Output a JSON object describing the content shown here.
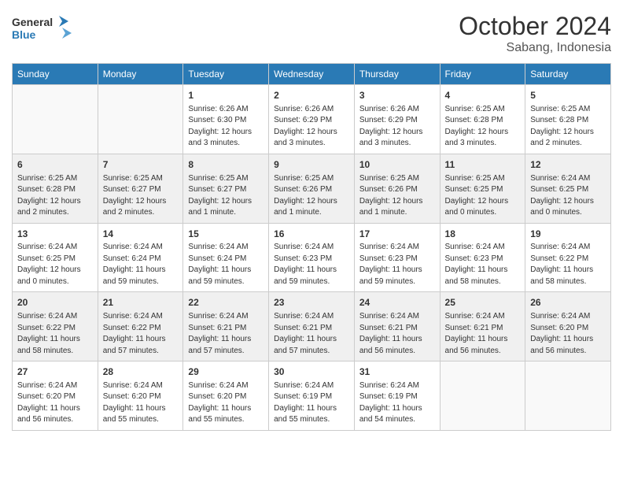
{
  "header": {
    "logo_general": "General",
    "logo_blue": "Blue",
    "month_title": "October 2024",
    "location": "Sabang, Indonesia"
  },
  "days_of_week": [
    "Sunday",
    "Monday",
    "Tuesday",
    "Wednesday",
    "Thursday",
    "Friday",
    "Saturday"
  ],
  "weeks": [
    {
      "shade": "white",
      "days": [
        {
          "num": "",
          "sunrise": "",
          "sunset": "",
          "daylight": ""
        },
        {
          "num": "",
          "sunrise": "",
          "sunset": "",
          "daylight": ""
        },
        {
          "num": "1",
          "sunrise": "Sunrise: 6:26 AM",
          "sunset": "Sunset: 6:30 PM",
          "daylight": "Daylight: 12 hours and 3 minutes."
        },
        {
          "num": "2",
          "sunrise": "Sunrise: 6:26 AM",
          "sunset": "Sunset: 6:29 PM",
          "daylight": "Daylight: 12 hours and 3 minutes."
        },
        {
          "num": "3",
          "sunrise": "Sunrise: 6:26 AM",
          "sunset": "Sunset: 6:29 PM",
          "daylight": "Daylight: 12 hours and 3 minutes."
        },
        {
          "num": "4",
          "sunrise": "Sunrise: 6:25 AM",
          "sunset": "Sunset: 6:28 PM",
          "daylight": "Daylight: 12 hours and 3 minutes."
        },
        {
          "num": "5",
          "sunrise": "Sunrise: 6:25 AM",
          "sunset": "Sunset: 6:28 PM",
          "daylight": "Daylight: 12 hours and 2 minutes."
        }
      ]
    },
    {
      "shade": "shaded",
      "days": [
        {
          "num": "6",
          "sunrise": "Sunrise: 6:25 AM",
          "sunset": "Sunset: 6:28 PM",
          "daylight": "Daylight: 12 hours and 2 minutes."
        },
        {
          "num": "7",
          "sunrise": "Sunrise: 6:25 AM",
          "sunset": "Sunset: 6:27 PM",
          "daylight": "Daylight: 12 hours and 2 minutes."
        },
        {
          "num": "8",
          "sunrise": "Sunrise: 6:25 AM",
          "sunset": "Sunset: 6:27 PM",
          "daylight": "Daylight: 12 hours and 1 minute."
        },
        {
          "num": "9",
          "sunrise": "Sunrise: 6:25 AM",
          "sunset": "Sunset: 6:26 PM",
          "daylight": "Daylight: 12 hours and 1 minute."
        },
        {
          "num": "10",
          "sunrise": "Sunrise: 6:25 AM",
          "sunset": "Sunset: 6:26 PM",
          "daylight": "Daylight: 12 hours and 1 minute."
        },
        {
          "num": "11",
          "sunrise": "Sunrise: 6:25 AM",
          "sunset": "Sunset: 6:25 PM",
          "daylight": "Daylight: 12 hours and 0 minutes."
        },
        {
          "num": "12",
          "sunrise": "Sunrise: 6:24 AM",
          "sunset": "Sunset: 6:25 PM",
          "daylight": "Daylight: 12 hours and 0 minutes."
        }
      ]
    },
    {
      "shade": "white",
      "days": [
        {
          "num": "13",
          "sunrise": "Sunrise: 6:24 AM",
          "sunset": "Sunset: 6:25 PM",
          "daylight": "Daylight: 12 hours and 0 minutes."
        },
        {
          "num": "14",
          "sunrise": "Sunrise: 6:24 AM",
          "sunset": "Sunset: 6:24 PM",
          "daylight": "Daylight: 11 hours and 59 minutes."
        },
        {
          "num": "15",
          "sunrise": "Sunrise: 6:24 AM",
          "sunset": "Sunset: 6:24 PM",
          "daylight": "Daylight: 11 hours and 59 minutes."
        },
        {
          "num": "16",
          "sunrise": "Sunrise: 6:24 AM",
          "sunset": "Sunset: 6:23 PM",
          "daylight": "Daylight: 11 hours and 59 minutes."
        },
        {
          "num": "17",
          "sunrise": "Sunrise: 6:24 AM",
          "sunset": "Sunset: 6:23 PM",
          "daylight": "Daylight: 11 hours and 59 minutes."
        },
        {
          "num": "18",
          "sunrise": "Sunrise: 6:24 AM",
          "sunset": "Sunset: 6:23 PM",
          "daylight": "Daylight: 11 hours and 58 minutes."
        },
        {
          "num": "19",
          "sunrise": "Sunrise: 6:24 AM",
          "sunset": "Sunset: 6:22 PM",
          "daylight": "Daylight: 11 hours and 58 minutes."
        }
      ]
    },
    {
      "shade": "shaded",
      "days": [
        {
          "num": "20",
          "sunrise": "Sunrise: 6:24 AM",
          "sunset": "Sunset: 6:22 PM",
          "daylight": "Daylight: 11 hours and 58 minutes."
        },
        {
          "num": "21",
          "sunrise": "Sunrise: 6:24 AM",
          "sunset": "Sunset: 6:22 PM",
          "daylight": "Daylight: 11 hours and 57 minutes."
        },
        {
          "num": "22",
          "sunrise": "Sunrise: 6:24 AM",
          "sunset": "Sunset: 6:21 PM",
          "daylight": "Daylight: 11 hours and 57 minutes."
        },
        {
          "num": "23",
          "sunrise": "Sunrise: 6:24 AM",
          "sunset": "Sunset: 6:21 PM",
          "daylight": "Daylight: 11 hours and 57 minutes."
        },
        {
          "num": "24",
          "sunrise": "Sunrise: 6:24 AM",
          "sunset": "Sunset: 6:21 PM",
          "daylight": "Daylight: 11 hours and 56 minutes."
        },
        {
          "num": "25",
          "sunrise": "Sunrise: 6:24 AM",
          "sunset": "Sunset: 6:21 PM",
          "daylight": "Daylight: 11 hours and 56 minutes."
        },
        {
          "num": "26",
          "sunrise": "Sunrise: 6:24 AM",
          "sunset": "Sunset: 6:20 PM",
          "daylight": "Daylight: 11 hours and 56 minutes."
        }
      ]
    },
    {
      "shade": "white",
      "days": [
        {
          "num": "27",
          "sunrise": "Sunrise: 6:24 AM",
          "sunset": "Sunset: 6:20 PM",
          "daylight": "Daylight: 11 hours and 56 minutes."
        },
        {
          "num": "28",
          "sunrise": "Sunrise: 6:24 AM",
          "sunset": "Sunset: 6:20 PM",
          "daylight": "Daylight: 11 hours and 55 minutes."
        },
        {
          "num": "29",
          "sunrise": "Sunrise: 6:24 AM",
          "sunset": "Sunset: 6:20 PM",
          "daylight": "Daylight: 11 hours and 55 minutes."
        },
        {
          "num": "30",
          "sunrise": "Sunrise: 6:24 AM",
          "sunset": "Sunset: 6:19 PM",
          "daylight": "Daylight: 11 hours and 55 minutes."
        },
        {
          "num": "31",
          "sunrise": "Sunrise: 6:24 AM",
          "sunset": "Sunset: 6:19 PM",
          "daylight": "Daylight: 11 hours and 54 minutes."
        },
        {
          "num": "",
          "sunrise": "",
          "sunset": "",
          "daylight": ""
        },
        {
          "num": "",
          "sunrise": "",
          "sunset": "",
          "daylight": ""
        }
      ]
    }
  ]
}
